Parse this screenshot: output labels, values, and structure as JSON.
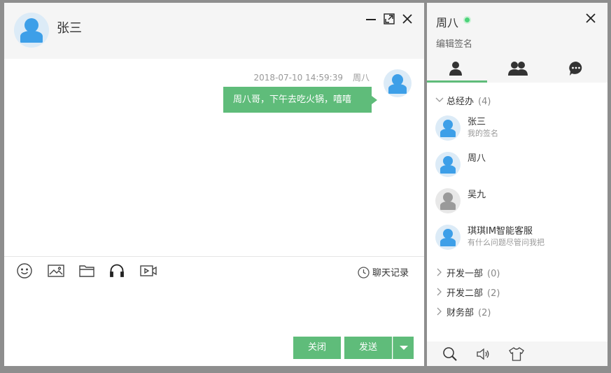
{
  "chat": {
    "title": "张三",
    "message": {
      "time": "2018-07-10 14:59:39",
      "sender": "周八",
      "text": "周八哥，下午去吃火锅，嘻嘻"
    },
    "toolbar": {
      "icons": [
        "smile-icon",
        "image-icon",
        "folder-icon",
        "headphones-icon",
        "video-icon"
      ],
      "history_label": "聊天记录"
    },
    "buttons": {
      "close_label": "关闭",
      "send_label": "发送"
    }
  },
  "panel": {
    "user_name": "周八",
    "signature": "编辑签名",
    "tabs": [
      "contacts-tab",
      "groups-tab",
      "messages-tab"
    ],
    "groups": [
      {
        "name": "总经办",
        "count": "(4)",
        "expanded": true,
        "members": [
          {
            "name": "张三",
            "signature": "我的签名",
            "status": "online"
          },
          {
            "name": "周八",
            "signature": "",
            "status": "online"
          },
          {
            "name": "吴九",
            "signature": "",
            "status": "offline"
          },
          {
            "name": "琪琪IM智能客服",
            "signature": "有什么问题尽管问我把",
            "status": "online"
          }
        ]
      },
      {
        "name": "开发一部",
        "count": "(0)",
        "expanded": false
      },
      {
        "name": "开发二部",
        "count": "(2)",
        "expanded": false
      },
      {
        "name": "财务部",
        "count": "(2)",
        "expanded": false
      }
    ]
  },
  "colors": {
    "accent": "#5fbc7a",
    "avatar": "#3d9fe8",
    "online": "#4cd37a"
  }
}
